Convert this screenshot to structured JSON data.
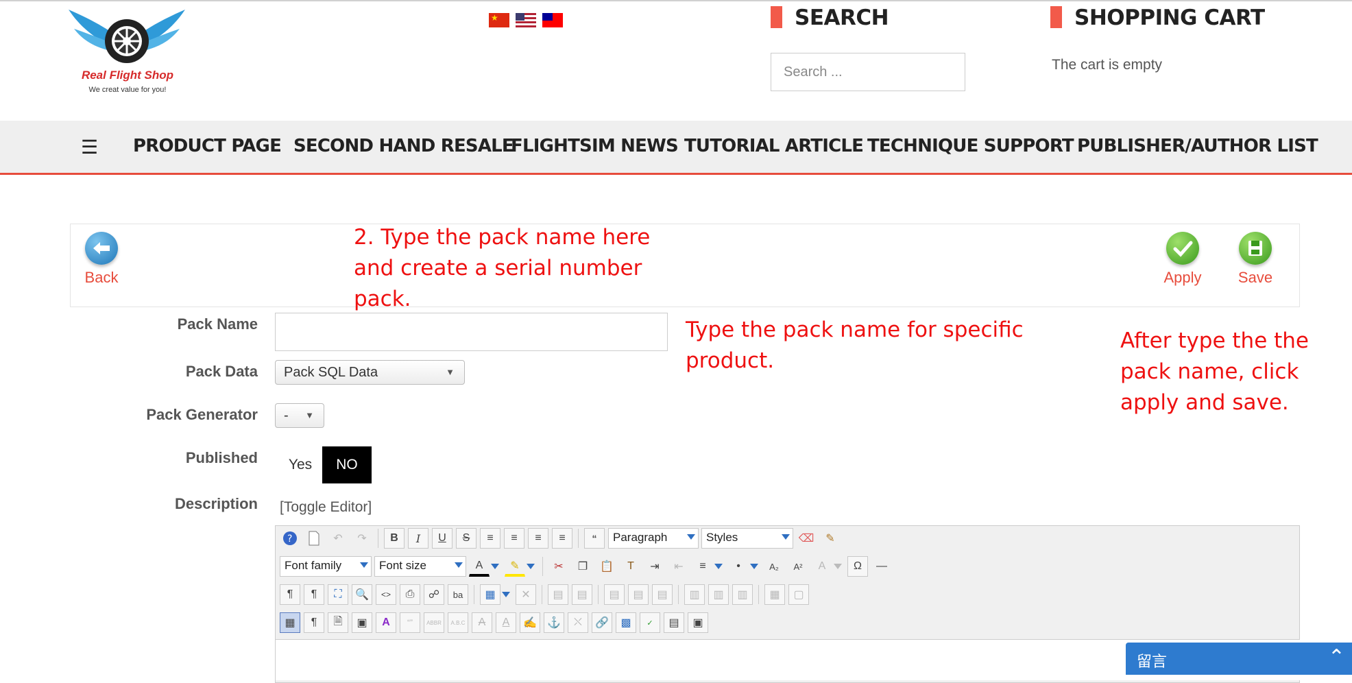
{
  "header": {
    "logo_text": "Real Flight Shop",
    "logo_tagline": "We creat value for you!",
    "flags": [
      "china-flag-icon",
      "usa-flag-icon",
      "taiwan-flag-icon"
    ],
    "search_title": "SEARCH",
    "search_placeholder": "Search ...",
    "cart_title": "SHOPPING CART",
    "cart_status": "The cart is empty",
    "accent_color": "#e74c3c"
  },
  "nav": {
    "menu_icon": "hamburger-icon",
    "items": [
      "PRODUCT PAGE",
      "SECOND HAND RESALE",
      "FLIGHTSIM NEWS",
      "TUTORIAL ARTICLE",
      "TECHNIQUE SUPPORT",
      "PUBLISHER/AUTHOR LIST"
    ]
  },
  "toolbar": {
    "back_label": "Back",
    "apply_label": "Apply",
    "save_label": "Save"
  },
  "annotations": {
    "note_pack_name_lines": [
      "2. Type the pack name here",
      "and create a serial number",
      "pack."
    ],
    "note_specific_lines": [
      "Type the pack name for specific",
      "product."
    ],
    "note_apply_lines": [
      "After type the the",
      "pack name, click",
      "apply and save."
    ]
  },
  "form": {
    "pack_name_label": "Pack Name",
    "pack_name_value": "",
    "pack_data_label": "Pack Data",
    "pack_data_value": "Pack SQL Data",
    "pack_generator_label": "Pack Generator",
    "pack_generator_value": "-",
    "published_label": "Published",
    "published_yes": "Yes",
    "published_no": "NO",
    "published_selected": "NO",
    "description_label": "Description",
    "toggle_editor": "[Toggle Editor]"
  },
  "editor": {
    "paragraph_value": "Paragraph",
    "styles_value": "Styles",
    "font_family_value": "Font family",
    "font_size_value": "Font size"
  },
  "chat": {
    "label": "留言"
  }
}
